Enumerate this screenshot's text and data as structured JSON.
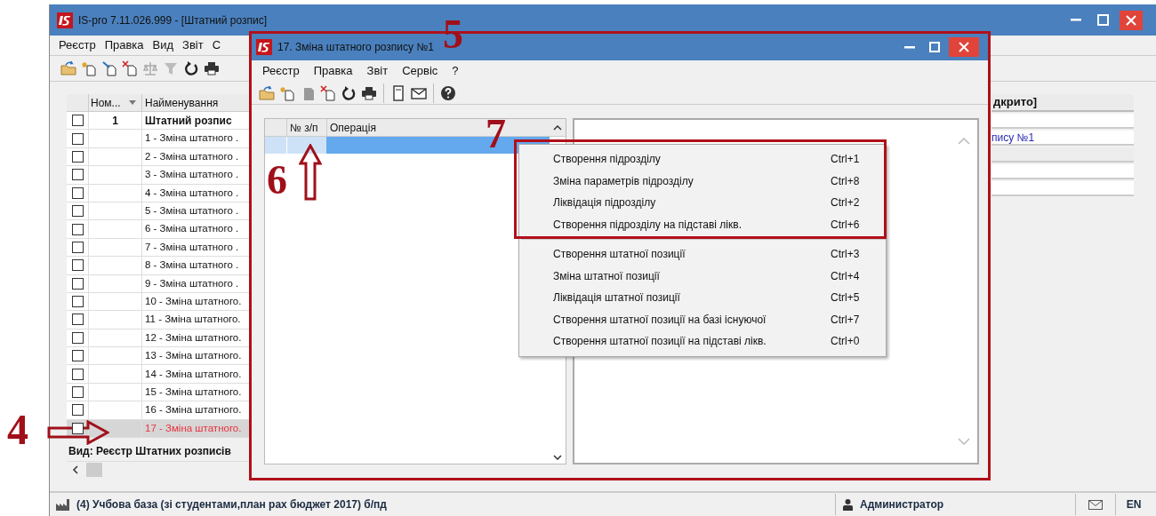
{
  "main_window": {
    "title": "IS-pro 7.11.026.999 - [Штатний розпис]",
    "menu": [
      "Реєстр",
      "Правка",
      "Вид",
      "Звіт",
      "С"
    ],
    "table": {
      "columns": [
        "Ном...",
        "Найменування"
      ],
      "rows": [
        {
          "number": "1",
          "name": "Штатний розпис",
          "kind": "group",
          "checked": false,
          "selected": false
        },
        {
          "name": "1 - Зміна штатного .",
          "kind": "item",
          "checked": false,
          "selected": false
        },
        {
          "name": "2 - Зміна штатного .",
          "kind": "item",
          "checked": false,
          "selected": false
        },
        {
          "name": "3 - Зміна штатного .",
          "kind": "item",
          "checked": false,
          "selected": false
        },
        {
          "name": "4 - Зміна штатного .",
          "kind": "item",
          "checked": false,
          "selected": false
        },
        {
          "name": "5 - Зміна штатного .",
          "kind": "item",
          "checked": false,
          "selected": false
        },
        {
          "name": "6 - Зміна штатного .",
          "kind": "item",
          "checked": false,
          "selected": false
        },
        {
          "name": "7 - Зміна штатного .",
          "kind": "item",
          "checked": false,
          "selected": false
        },
        {
          "name": "8 - Зміна штатного .",
          "kind": "item",
          "checked": false,
          "selected": false
        },
        {
          "name": "9 - Зміна штатного .",
          "kind": "item",
          "checked": false,
          "selected": false
        },
        {
          "name": "10 - Зміна штатного.",
          "kind": "item",
          "checked": false,
          "selected": false
        },
        {
          "name": "11 - Зміна штатного.",
          "kind": "item",
          "checked": false,
          "selected": false
        },
        {
          "name": "12 - Зміна штатного.",
          "kind": "item",
          "checked": false,
          "selected": false
        },
        {
          "name": "13 - Зміна штатного.",
          "kind": "item",
          "checked": false,
          "selected": false
        },
        {
          "name": "14 - Зміна штатного.",
          "kind": "item",
          "checked": false,
          "selected": false
        },
        {
          "name": "15 - Зміна штатного.",
          "kind": "item",
          "checked": false,
          "selected": false
        },
        {
          "name": "16 - Зміна штатного.",
          "kind": "item",
          "checked": false,
          "selected": false
        },
        {
          "name": "17 - Зміна штатного.",
          "kind": "item",
          "checked": false,
          "selected": true
        }
      ]
    },
    "view_label": "Вид: Реєстр Штатних розписів",
    "right_panel": {
      "header": "дкрито]",
      "rows": [
        {
          "kind": "field"
        },
        {
          "kind": "field",
          "text": "пису №1"
        },
        {
          "kind": "section"
        },
        {
          "kind": "field"
        },
        {
          "kind": "field"
        }
      ]
    },
    "status_bar": {
      "database": "(4) Учбова база (зі студентами,план рах бюджет 2017) б/пд",
      "user": "Администратор",
      "language": "EN"
    }
  },
  "dialog": {
    "title": "17. Зміна штатного розпису №1",
    "menu": [
      "Реєстр",
      "Правка",
      "Звіт",
      "Сервіс",
      "?"
    ],
    "table": {
      "columns": [
        "№ з/п",
        "Операція"
      ],
      "rows": [
        {
          "selected": true
        }
      ]
    }
  },
  "context_menu": {
    "groups": [
      [
        {
          "label": "Створення підрозділу",
          "shortcut": "Ctrl+1"
        },
        {
          "label": "Зміна параметрів підрозділу",
          "shortcut": "Ctrl+8"
        },
        {
          "label": "Ліквідація підрозділу",
          "shortcut": "Ctrl+2"
        },
        {
          "label": "Створення підрозділу на підставі лікв.",
          "shortcut": "Ctrl+6"
        }
      ],
      [
        {
          "label": "Створення штатної позиції",
          "shortcut": "Ctrl+3"
        },
        {
          "label": "Зміна штатної позиції",
          "shortcut": "Ctrl+4"
        },
        {
          "label": "Ліквідація штатної позиції",
          "shortcut": "Ctrl+5"
        },
        {
          "label": "Створення штатної позиції на базі існуючої",
          "shortcut": "Ctrl+7"
        },
        {
          "label": "Створення штатної позиції на підставі лікв.",
          "shortcut": "Ctrl+0"
        }
      ]
    ]
  },
  "annotations": [
    {
      "text": "4"
    },
    {
      "text": "5"
    },
    {
      "text": "6"
    },
    {
      "text": "7"
    }
  ]
}
